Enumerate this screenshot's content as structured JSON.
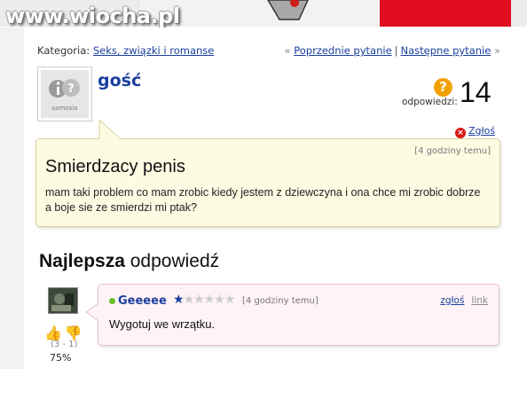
{
  "logo": {
    "text": "www.wiocha.pl"
  },
  "breadcrumb": {
    "label": "Kategoria:",
    "category": "Seks, związki i romanse"
  },
  "nav": {
    "prev_arrow": "«",
    "prev": "Poprzednie pytanie",
    "separator": "|",
    "next": "Następne pytanie",
    "next_arrow": "»"
  },
  "question": {
    "user": "gość",
    "avatar_text": "samosia",
    "answers_label": "odpowiedzi:",
    "answers_count": "14",
    "report": "Zgłoś",
    "time": "[4 godziny temu]",
    "title": "Smierdzacy penis",
    "body": "mam taki problem co mam zrobic kiedy jestem z dziewczyna i ona chce mi zrobic dobrze a boje sie ze smierdzi mi ptak?"
  },
  "best_answer": {
    "heading_bold": "Najlepsza",
    "heading_rest": " odpowiedź",
    "user": "Geeeee",
    "rating": 1,
    "rating_max": 6,
    "time": "[4 godziny temu]",
    "report_link": "zgłoś",
    "link": "link",
    "text": "Wygotuj we wrzątku.",
    "votes": "(3 - 1)",
    "percent": "75%"
  },
  "colors": {
    "link": "#1a3f9e",
    "question_bg": "#fdfbe2",
    "answer_bg": "#fff3f5",
    "brand_red": "#e10d1f"
  }
}
